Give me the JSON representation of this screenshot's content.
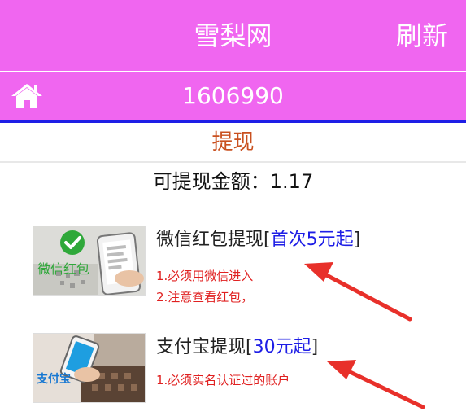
{
  "header": {
    "title": "雪梨网",
    "refresh_label": "刷新"
  },
  "subheader": {
    "user_id": "1606990"
  },
  "section": {
    "title": "提现"
  },
  "balance": {
    "text": "可提现金额：1.17"
  },
  "options": [
    {
      "title": "微信红包提现",
      "bracket_open": "[",
      "highlight": "首次5元起",
      "bracket_close": "]",
      "notes": [
        "1.必须用微信进入",
        "2.注意查看红包，"
      ],
      "logo_text": "微信红包"
    },
    {
      "title": "支付宝提现",
      "bracket_open": "[",
      "highlight": "30元起",
      "bracket_close": "]",
      "notes": [
        "1.必须实名认证过的账户"
      ],
      "logo_text": "支付宝"
    }
  ],
  "colors": {
    "header": "#f066f0",
    "accent_blue": "#1e1ee6",
    "section_title": "#c9501f",
    "note_red": "#e02020",
    "arrow_red": "#e8302a"
  },
  "icons": {
    "home": "home-icon",
    "arrow": "red-arrow"
  }
}
